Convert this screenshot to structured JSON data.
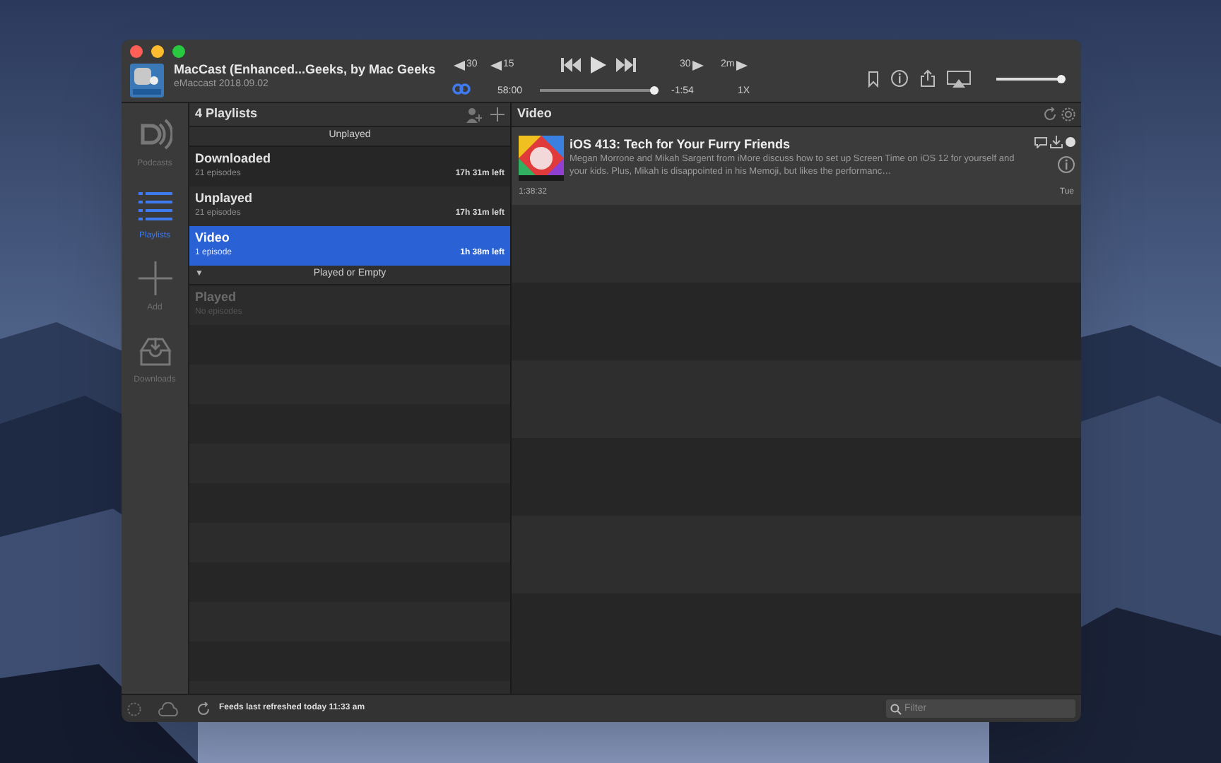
{
  "window": {
    "title": "MacCast (Enhanced...Geeks, by Mac Geeks",
    "subtitle": "eMaccast 2018.09.02"
  },
  "player": {
    "skip_back": [
      "30",
      "15"
    ],
    "skip_forward": [
      "30",
      "2m"
    ],
    "elapsed": "58:00",
    "remaining": "-1:54",
    "speed": "1X",
    "progress": {
      "level": 0.97
    },
    "volume": {
      "level": 0.95
    }
  },
  "sidebar": {
    "items": [
      {
        "kind": "podcasts",
        "label": "Podcasts",
        "selected": false
      },
      {
        "kind": "playlists",
        "label": "Playlists",
        "selected": true
      },
      {
        "kind": "add",
        "label": "Add",
        "selected": false
      },
      {
        "kind": "downloads",
        "label": "Downloads",
        "selected": false
      }
    ]
  },
  "playlists": {
    "title": "4 Playlists",
    "sections": [
      {
        "title": "Unplayed",
        "items": [
          {
            "name": "Downloaded",
            "count": "21 episodes",
            "remaining": "17h 31m left",
            "selected": false,
            "disabled": false
          },
          {
            "name": "Unplayed",
            "count": "21 episodes",
            "remaining": "17h 31m left",
            "selected": false,
            "disabled": false
          },
          {
            "name": "Video",
            "count": "1 episode",
            "remaining": "1h 38m left",
            "selected": true,
            "disabled": false
          }
        ]
      },
      {
        "title": "Played or Empty",
        "toggle": "▼",
        "items": [
          {
            "name": "Played",
            "count": "No episodes",
            "selected": false,
            "disabled": true
          }
        ]
      }
    ]
  },
  "episodes": {
    "title": "Video",
    "items": [
      {
        "title": "iOS 413: Tech for Your Furry Friends",
        "description": "Megan Morrone and Mikah Sargent from iMore discuss how to set up Screen Time on iOS 12 for yourself and your kids. Plus, Mikah is disappointed in his Memoji, but likes the performanc…",
        "duration": "1:38:32",
        "date": "Tue"
      }
    ]
  },
  "status_bar": {
    "text": "Feeds last refreshed today 11:33 am",
    "search": {
      "placeholder": "Filter"
    }
  }
}
